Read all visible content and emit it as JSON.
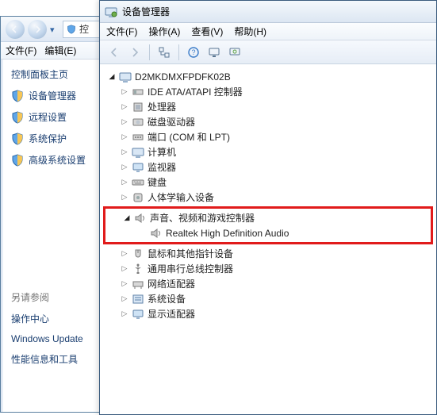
{
  "back_window": {
    "menu": {
      "file": "文件(F)",
      "edit": "编辑(E)"
    },
    "address_fragment": "控",
    "sidebar": {
      "home": "控制面板主页",
      "links": [
        {
          "label": "设备管理器"
        },
        {
          "label": "远程设置"
        },
        {
          "label": "系统保护"
        },
        {
          "label": "高级系统设置"
        }
      ],
      "see_also_header": "另请参阅",
      "see_also": [
        "操作中心",
        "Windows Update",
        "性能信息和工具"
      ]
    }
  },
  "front_window": {
    "title": "设备管理器",
    "menu": {
      "file": "文件(F)",
      "action": "操作(A)",
      "view": "查看(V)",
      "help": "帮助(H)"
    },
    "root": "D2MKDMXFPDFK02B",
    "categories": [
      {
        "label": "IDE ATA/ATAPI 控制器",
        "icon": "ide"
      },
      {
        "label": "处理器",
        "icon": "cpu"
      },
      {
        "label": "磁盘驱动器",
        "icon": "disk"
      },
      {
        "label": "端口 (COM 和 LPT)",
        "icon": "port"
      },
      {
        "label": "计算机",
        "icon": "computer"
      },
      {
        "label": "监视器",
        "icon": "monitor"
      },
      {
        "label": "键盘",
        "icon": "keyboard"
      },
      {
        "label": "人体学输入设备",
        "icon": "hid"
      }
    ],
    "highlighted": {
      "category": "声音、视频和游戏控制器",
      "child": "Realtek High Definition Audio"
    },
    "categories_after": [
      {
        "label": "鼠标和其他指针设备",
        "icon": "mouse"
      },
      {
        "label": "通用串行总线控制器",
        "icon": "usb"
      },
      {
        "label": "网络适配器",
        "icon": "network"
      },
      {
        "label": "系统设备",
        "icon": "system"
      },
      {
        "label": "显示适配器",
        "icon": "display"
      }
    ]
  },
  "colors": {
    "highlight_border": "#e11b1b",
    "window_border": "#3b5c7e",
    "link_color": "#1a3e70"
  }
}
